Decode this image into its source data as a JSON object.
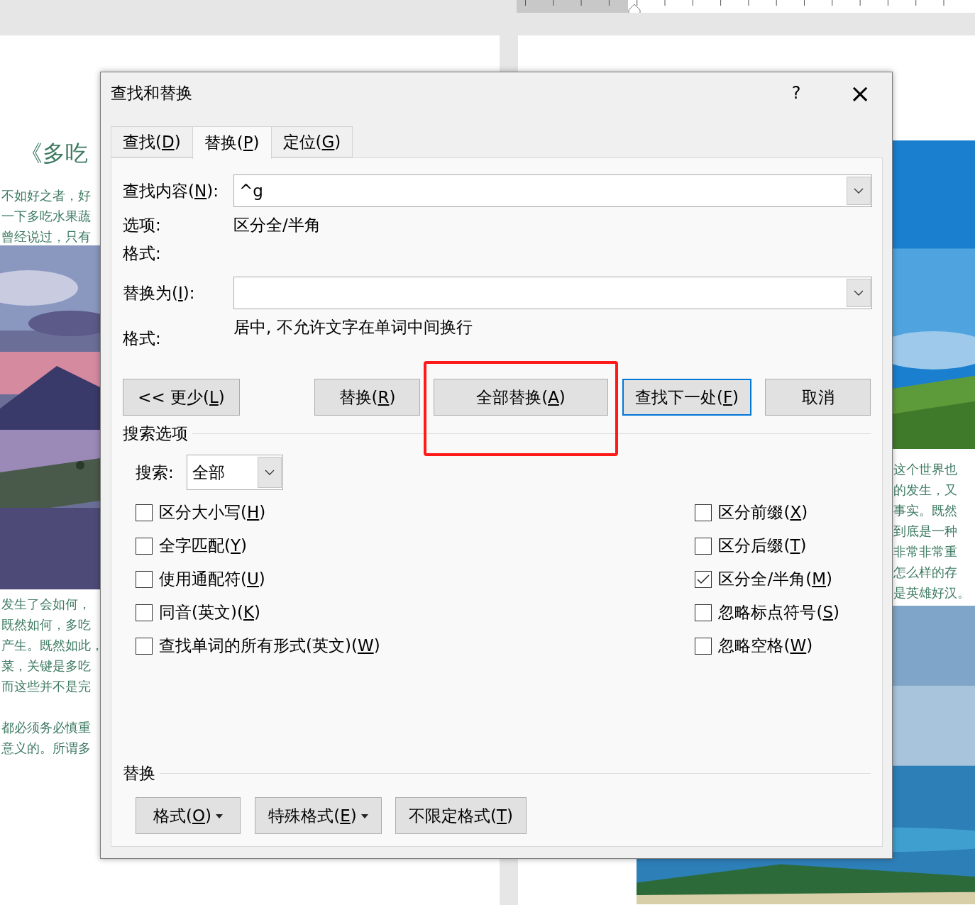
{
  "left_page": {
    "title": "《多吃",
    "lines_top": [
      "不如好之者，好",
      "一下多吃水果蔬",
      "曾经说过，只有"
    ],
    "photo": {
      "kind": "picture"
    },
    "lines_bottom": [
      "发生了会如何，",
      "既然如何，多吃",
      "产生。既然如此，",
      "菜，关键是多吃",
      "而这些并不是完"
    ],
    "lines_end": [
      "都必须务必慎重",
      "意义的。所谓多"
    ]
  },
  "right_page": {
    "photo_top": {
      "kind": "picture"
    },
    "lines": [
      "这个世界也",
      "的发生，又",
      "事实。既然",
      "到底是一种",
      "非常非常重",
      "怎么样的存",
      "是英雄好汉。"
    ],
    "photo_bottom": {
      "kind": "picture"
    }
  },
  "dialog": {
    "title": "查找和替换",
    "help": "?",
    "close": "×",
    "tabs": [
      {
        "label": {
          "text": "查找(",
          "key": "D",
          "tail": ")"
        },
        "selected": false
      },
      {
        "label": {
          "text": "替换(",
          "key": "P",
          "tail": ")"
        },
        "selected": true
      },
      {
        "label": {
          "text": "定位(",
          "key": "G",
          "tail": ")"
        },
        "selected": false
      }
    ],
    "find": {
      "label": {
        "text": "查找内容(",
        "key": "N",
        "tail": "):"
      },
      "value": "^g",
      "options_label": "选项:",
      "options_value": "区分全/半角",
      "format_label": "格式:"
    },
    "replace": {
      "label": {
        "text": "替换为(",
        "key": "I",
        "tail": "):"
      },
      "format_label": "格式:",
      "format_value": "居中, 不允许文字在单词中间换行"
    },
    "buttons": [
      {
        "label": {
          "text": "<< 更少(",
          "key": "L",
          "tail": ")"
        },
        "focused": false
      },
      {
        "label": {
          "text": "替换(",
          "key": "R",
          "tail": ")"
        },
        "focused": false
      },
      {
        "label": {
          "text": "全部替换(",
          "key": "A",
          "tail": ")"
        },
        "focused": false
      },
      {
        "label": {
          "text": "查找下一处(",
          "key": "F",
          "tail": ")"
        },
        "focused": true
      },
      {
        "label": {
          "text": "取消"
        },
        "focused": false
      }
    ],
    "search_options": {
      "heading": "搜索选项",
      "search_label": {
        "text": "搜索",
        "tail": ":"
      },
      "search_value": "全部",
      "left": [
        {
          "label": {
            "text": "区分大小写(",
            "key": "H",
            "tail": ")"
          },
          "checked": false
        },
        {
          "label": {
            "text": "全字匹配(",
            "key": "Y",
            "tail": ")"
          },
          "checked": false
        },
        {
          "label": {
            "text": "使用通配符(",
            "key": "U",
            "tail": ")"
          },
          "checked": false
        },
        {
          "label": {
            "text": "同音(英文)(",
            "key": "K",
            "tail": ")"
          },
          "checked": false
        },
        {
          "label": {
            "text": "查找单词的所有形式(英文)(",
            "key": "W",
            "tail": ")"
          },
          "checked": false
        }
      ],
      "right": [
        {
          "label": {
            "text": "区分前缀(",
            "key": "X",
            "tail": ")"
          },
          "checked": false
        },
        {
          "label": {
            "text": "区分后缀(",
            "key": "T",
            "tail": ")"
          },
          "checked": false
        },
        {
          "label": {
            "text": "区分全/半角(",
            "key": "M",
            "tail": ")"
          },
          "checked": true
        },
        {
          "label": {
            "text": "忽略标点符号(",
            "key": "S",
            "tail": ")"
          },
          "checked": false
        },
        {
          "label": {
            "text": "忽略空格(",
            "key": "W",
            "tail": ")"
          },
          "checked": false
        }
      ]
    },
    "replace_section": {
      "heading": "替换",
      "buttons": [
        {
          "label": {
            "text": "格式(",
            "key": "O",
            "tail": ")"
          },
          "dropdown": true
        },
        {
          "label": {
            "text": "特殊格式(",
            "key": "E",
            "tail": ")"
          },
          "dropdown": true
        },
        {
          "label": {
            "text": "不限定格式(",
            "key": "T",
            "tail": ")"
          },
          "dropdown": false
        }
      ]
    }
  }
}
